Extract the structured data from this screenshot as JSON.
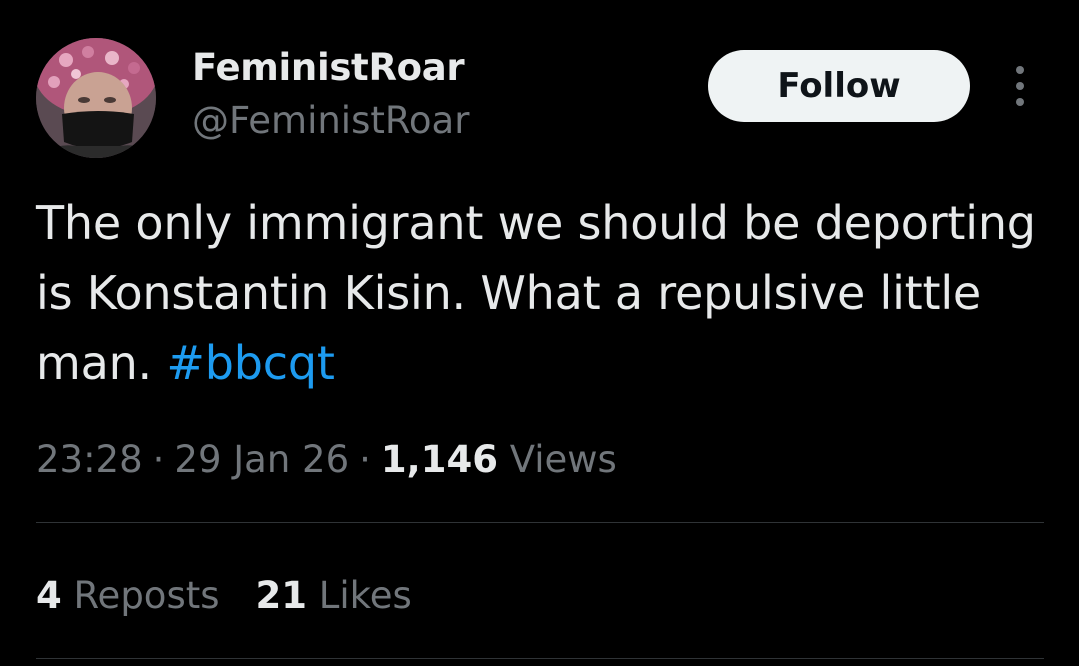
{
  "author": {
    "display_name": "FeministRoar",
    "handle": "@FeministRoar"
  },
  "actions": {
    "follow_label": "Follow",
    "more_icon": "more-vertical-icon"
  },
  "tweet": {
    "text_before": "The only immigrant we should be deporting is Konstantin Kisin. What a repulsive little man. ",
    "hashtag": "#bbcqt"
  },
  "meta": {
    "time": "23:28",
    "date": "29 Jan 26",
    "views_count": "1,146",
    "views_label": "Views"
  },
  "stats": {
    "reposts_count": "4",
    "reposts_label": "Reposts",
    "likes_count": "21",
    "likes_label": "Likes"
  },
  "colors": {
    "background": "#000000",
    "text": "#e7e9ea",
    "muted": "#71767b",
    "link": "#1d9bf0",
    "follow_button": "#eff3f4"
  }
}
